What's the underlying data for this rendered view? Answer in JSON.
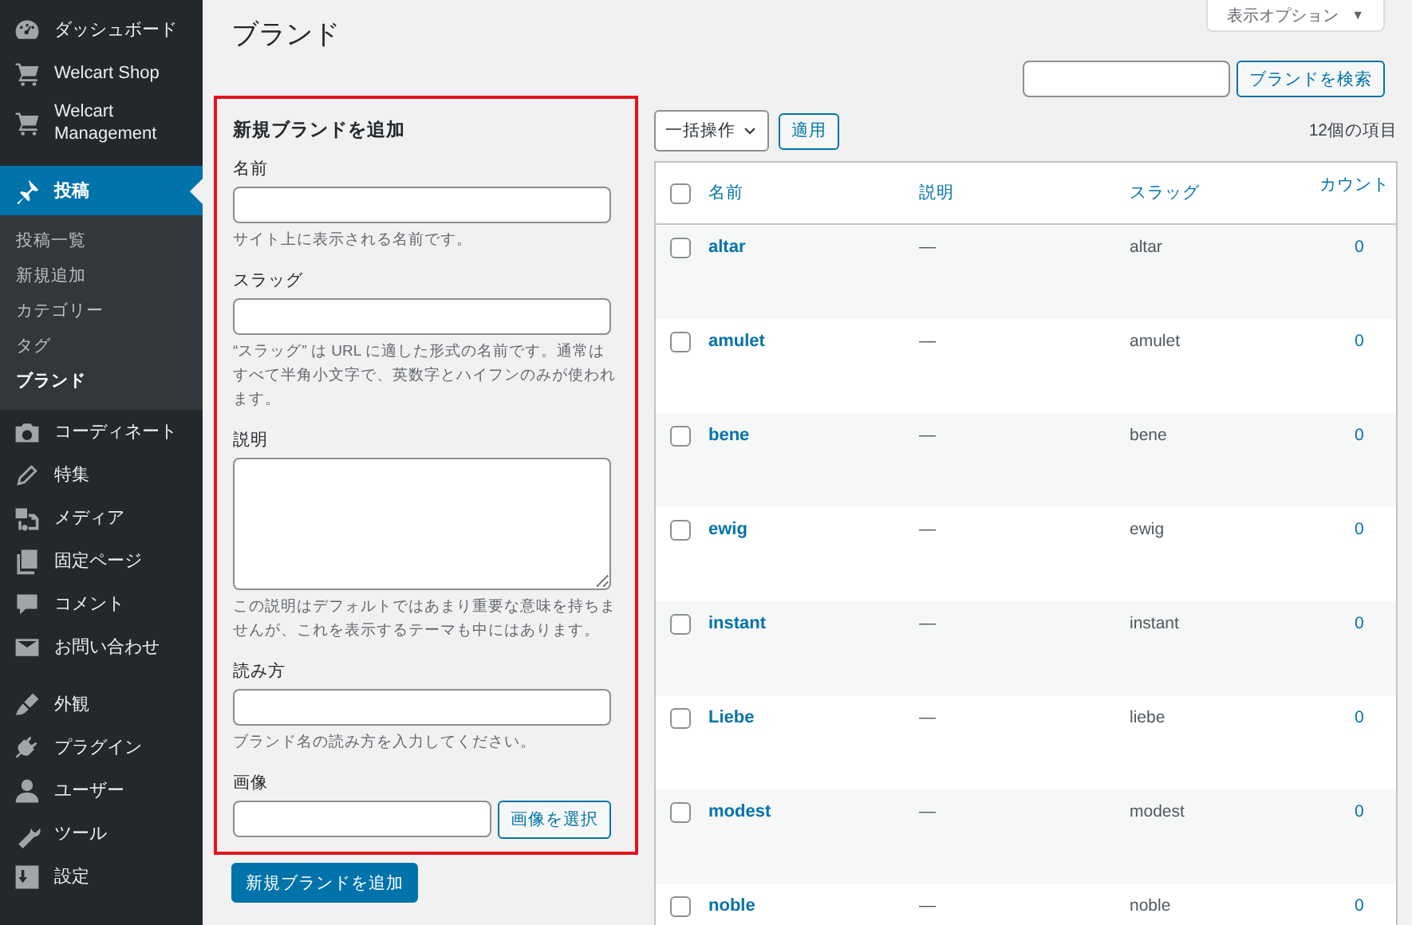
{
  "sidebar": {
    "groups": [
      {
        "items": [
          {
            "label": "ダッシュボード",
            "selected": false
          },
          {
            "label": "Welcart Shop",
            "selected": false
          },
          {
            "label": "Welcart Management",
            "selected": false
          }
        ]
      },
      {
        "items": [
          {
            "label": "投稿",
            "selected": true,
            "submenu": [
              {
                "label": "投稿一覧",
                "selected": false
              },
              {
                "label": "新規追加",
                "selected": false
              },
              {
                "label": "カテゴリー",
                "selected": false
              },
              {
                "label": "タグ",
                "selected": false
              },
              {
                "label": "ブランド",
                "selected": true
              }
            ]
          },
          {
            "label": "コーディネート",
            "selected": false
          },
          {
            "label": "特集",
            "selected": false
          },
          {
            "label": "メディア",
            "selected": false
          },
          {
            "label": "固定ページ",
            "selected": false
          },
          {
            "label": "コメント",
            "selected": false
          },
          {
            "label": "お問い合わせ",
            "selected": false
          }
        ]
      },
      {
        "items": [
          {
            "label": "外観",
            "selected": false
          },
          {
            "label": "プラグイン",
            "selected": false
          },
          {
            "label": "ユーザー",
            "selected": false
          },
          {
            "label": "ツール",
            "selected": false
          },
          {
            "label": "設定",
            "selected": false
          }
        ]
      }
    ]
  },
  "page": {
    "title": "ブランド",
    "screen_options": {
      "label": "表示オプション",
      "caret": "▼"
    }
  },
  "search": {
    "button": "ブランドを検索"
  },
  "add_form": {
    "title": "新規ブランドを追加",
    "highlighted": true,
    "fields": [
      {
        "kind": "text",
        "label": "名前",
        "description": "サイト上に表示される名前です。"
      },
      {
        "kind": "text",
        "label": "スラッグ",
        "description": "“スラッグ” は URL に適した形式の名前です。通常はすべて半角小文字で、英数字とハイフンのみが使われます。"
      },
      {
        "kind": "textarea",
        "label": "説明",
        "description": "この説明はデフォルトではあまり重要な意味を持ちませんが、これを表示するテーマも中にはあります。"
      },
      {
        "kind": "text",
        "label": "読み方",
        "description": "ブランド名の読み方を入力してください。"
      },
      {
        "kind": "image",
        "label": "画像",
        "button": "画像を選択"
      }
    ],
    "submit": "新規ブランドを追加"
  },
  "bulk_actions": {
    "select": "一括操作",
    "apply": "適用"
  },
  "item_count": "12個の項目",
  "table": {
    "select_all_checked": false,
    "columns": [
      "名前",
      "説明",
      "スラッグ",
      "カウント"
    ],
    "rows": [
      {
        "name": "altar",
        "description": "—",
        "slug": "altar",
        "count": "0",
        "checked": false
      },
      {
        "name": "amulet",
        "description": "—",
        "slug": "amulet",
        "count": "0",
        "checked": false
      },
      {
        "name": "bene",
        "description": "—",
        "slug": "bene",
        "count": "0",
        "checked": false
      },
      {
        "name": "ewig",
        "description": "—",
        "slug": "ewig",
        "count": "0",
        "checked": false
      },
      {
        "name": "instant",
        "description": "—",
        "slug": "instant",
        "count": "0",
        "checked": false
      },
      {
        "name": "Liebe",
        "description": "—",
        "slug": "liebe",
        "count": "0",
        "checked": false
      },
      {
        "name": "modest",
        "description": "—",
        "slug": "modest",
        "count": "0",
        "checked": false
      },
      {
        "name": "noble",
        "description": "—",
        "slug": "noble",
        "count": "0",
        "checked": false
      }
    ]
  }
}
